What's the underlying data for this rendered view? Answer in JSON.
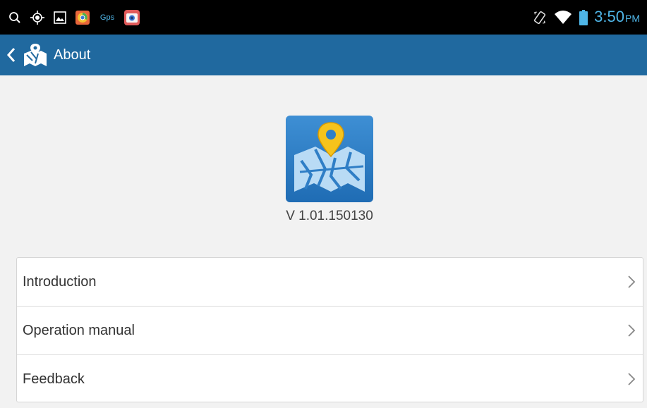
{
  "status_bar": {
    "left_icons": [
      "search-icon",
      "gps-target-icon",
      "gallery-icon",
      "chrome-app-icon",
      "gps-app-icon",
      "camera-app-icon"
    ],
    "gps_label": "Gps",
    "right_icons": [
      "vibrate-icon",
      "wifi-icon",
      "battery-icon"
    ],
    "time": "3:50",
    "ampm": "PM",
    "accent_color": "#4fb6e8"
  },
  "action_bar": {
    "title": "About",
    "back_icon": "chevron-left-icon",
    "app_icon": "map-pin-app-icon",
    "background_color": "#20699f"
  },
  "app_info": {
    "logo_icon": "map-pin-app-icon",
    "version": "V 1.01.150130"
  },
  "menu": {
    "items": [
      {
        "label": "Introduction",
        "icon": "chevron-right-icon"
      },
      {
        "label": "Operation manual",
        "icon": "chevron-right-icon"
      },
      {
        "label": "Feedback",
        "icon": "chevron-right-icon"
      }
    ]
  }
}
